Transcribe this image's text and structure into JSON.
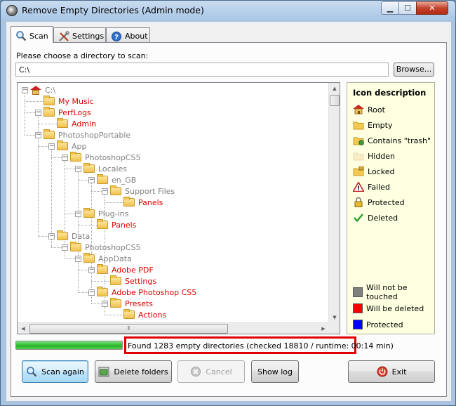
{
  "window": {
    "title": "Remove Empty Directories (Admin mode)"
  },
  "tabs": [
    {
      "label": "Scan",
      "icon": "magnifier-icon"
    },
    {
      "label": "Settings",
      "icon": "tools-icon"
    },
    {
      "label": "About",
      "icon": "help-icon"
    }
  ],
  "scan": {
    "prompt": "Please choose a directory to scan:",
    "directory": "C:\\",
    "browse_label": "Browse..."
  },
  "tree": {
    "nodes": [
      {
        "label": "C:\\",
        "color": "gray",
        "type": "root"
      },
      {
        "label": "My Music",
        "color": "red"
      },
      {
        "label": "PerfLogs",
        "color": "red"
      },
      {
        "label": "Admin",
        "color": "red"
      },
      {
        "label": "PhotoshopPortable",
        "color": "gray"
      },
      {
        "label": "App",
        "color": "gray"
      },
      {
        "label": "PhotoshopCS5",
        "color": "gray"
      },
      {
        "label": "Locales",
        "color": "gray"
      },
      {
        "label": "en_GB",
        "color": "gray"
      },
      {
        "label": "Support Files",
        "color": "gray"
      },
      {
        "label": "Panels",
        "color": "red"
      },
      {
        "label": "Plug-ins",
        "color": "gray"
      },
      {
        "label": "Panels",
        "color": "red"
      },
      {
        "label": "Data",
        "color": "gray"
      },
      {
        "label": "PhotoshopCS5",
        "color": "gray"
      },
      {
        "label": "AppData",
        "color": "gray"
      },
      {
        "label": "Adobe PDF",
        "color": "red"
      },
      {
        "label": "Settings",
        "color": "red"
      },
      {
        "label": "Adobe Photoshop CS5",
        "color": "red"
      },
      {
        "label": "Presets",
        "color": "red"
      },
      {
        "label": "Actions",
        "color": "red"
      }
    ]
  },
  "legend": {
    "title": "Icon description",
    "items": [
      {
        "label": "Root",
        "icon": "root-icon"
      },
      {
        "label": "Empty",
        "icon": "empty-folder-icon"
      },
      {
        "label": "Contains \"trash\"",
        "icon": "trash-folder-icon"
      },
      {
        "label": "Hidden",
        "icon": "hidden-folder-icon"
      },
      {
        "label": "Locked",
        "icon": "locked-folder-icon"
      },
      {
        "label": "Failed",
        "icon": "warning-icon"
      },
      {
        "label": "Protected",
        "icon": "padlock-icon"
      },
      {
        "label": "Deleted",
        "icon": "checkmark-icon"
      }
    ],
    "colors": [
      {
        "label": "Will not be touched",
        "color": "#808080"
      },
      {
        "label": "Will be deleted",
        "color": "#ff0000"
      },
      {
        "label": "Protected",
        "color": "#0000ff"
      }
    ]
  },
  "status": {
    "progress": 1.0,
    "text": "Found 1283 empty directories (checked 18810 / runtime: 00:14 min)"
  },
  "buttons": {
    "scan_again": "Scan again",
    "delete_folders": "Delete folders",
    "cancel": "Cancel",
    "show_log": "Show log",
    "exit": "Exit"
  }
}
